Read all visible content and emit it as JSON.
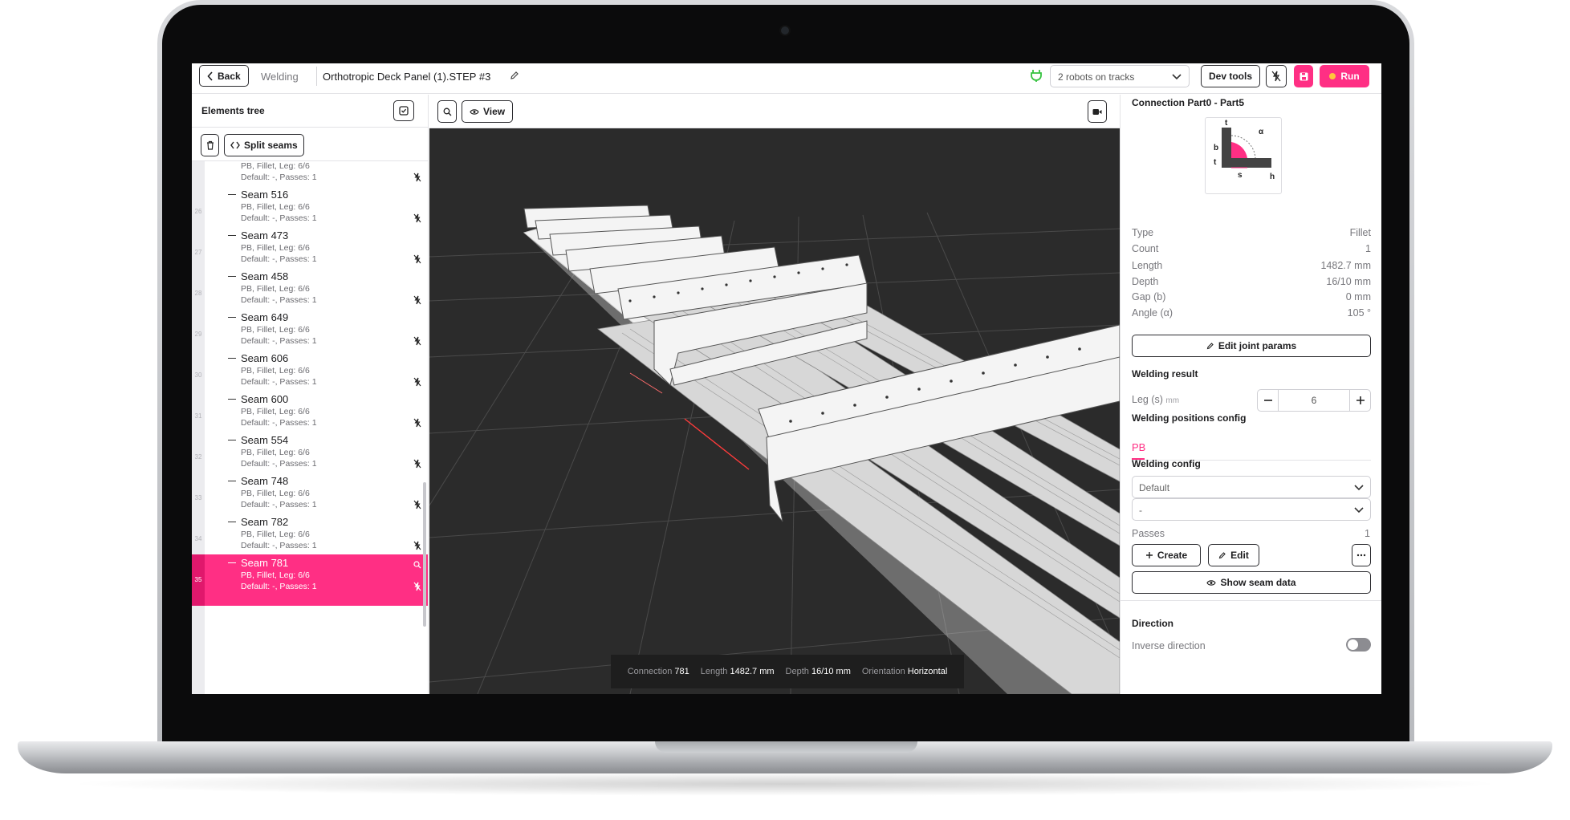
{
  "header": {
    "back_label": "Back",
    "section": "Welding",
    "document_title": "Orthotropic Deck Panel (1).STEP #3",
    "robot_select": "2 robots on tracks",
    "dev_tools_label": "Dev tools",
    "run_label": "Run",
    "accent_color": "#ff2f84"
  },
  "tree": {
    "title": "Elements tree",
    "split_seams_label": "Split seams",
    "partial_top": {
      "line1": "PB, Fillet, Leg: 6/6",
      "line2": "Default: -, Passes: 1"
    },
    "seams": [
      {
        "num": "26",
        "name": "Seam 516",
        "line1": "PB, Fillet, Leg: 6/6",
        "line2": "Default: -, Passes: 1"
      },
      {
        "num": "27",
        "name": "Seam 473",
        "line1": "PB, Fillet, Leg: 6/6",
        "line2": "Default: -, Passes: 1"
      },
      {
        "num": "28",
        "name": "Seam 458",
        "line1": "PB, Fillet, Leg: 6/6",
        "line2": "Default: -, Passes: 1"
      },
      {
        "num": "29",
        "name": "Seam 649",
        "line1": "PB, Fillet, Leg: 6/6",
        "line2": "Default: -, Passes: 1"
      },
      {
        "num": "30",
        "name": "Seam 606",
        "line1": "PB, Fillet, Leg: 6/6",
        "line2": "Default: -, Passes: 1"
      },
      {
        "num": "31",
        "name": "Seam 600",
        "line1": "PB, Fillet, Leg: 6/6",
        "line2": "Default: -, Passes: 1"
      },
      {
        "num": "32",
        "name": "Seam 554",
        "line1": "PB, Fillet, Leg: 6/6",
        "line2": "Default: -, Passes: 1"
      },
      {
        "num": "33",
        "name": "Seam 748",
        "line1": "PB, Fillet, Leg: 6/6",
        "line2": "Default: -, Passes: 1"
      },
      {
        "num": "34",
        "name": "Seam 782",
        "line1": "PB, Fillet, Leg: 6/6",
        "line2": "Default: -, Passes: 1"
      },
      {
        "num": "35",
        "name": "Seam 781",
        "line1": "PB, Fillet, Leg: 6/6",
        "line2": "Default: -, Passes: 1",
        "selected": true
      }
    ]
  },
  "viewport": {
    "view_label": "View",
    "status": {
      "connection_label": "Connection",
      "connection_value": "781",
      "length_label": "Length",
      "length_value": "1482.7 mm",
      "depth_label": "Depth",
      "depth_value": "16/10 mm",
      "orientation_label": "Orientation",
      "orientation_value": "Horizontal"
    }
  },
  "details": {
    "connection_title": "Connection Part0 - Part5",
    "diagram_labels": {
      "t_top": "t",
      "a": "α",
      "b": "b",
      "t_left": "t",
      "s": "s",
      "h": "h"
    },
    "properties": [
      {
        "key": "Type",
        "value": "Fillet"
      },
      {
        "key": "Count",
        "value": "1"
      },
      {
        "key": "Length",
        "value": "1482.7 mm"
      },
      {
        "key": "Depth",
        "value": "16/10 mm"
      },
      {
        "key": "Gap (b)",
        "value": "0 mm"
      },
      {
        "key": "Angle (α)",
        "value": "105 °"
      }
    ],
    "edit_joint_label": "Edit joint params",
    "welding_result_title": "Welding result",
    "leg_label": "Leg (s)",
    "leg_unit": "mm",
    "leg_value": "6",
    "positions_title": "Welding positions config",
    "position_tab": "PB",
    "welding_config_title": "Welding config",
    "config_select": "Default",
    "config_sub_select": "-",
    "passes_label": "Passes",
    "passes_value": "1",
    "create_label": "Create",
    "edit_label": "Edit",
    "show_seam_data_label": "Show seam data",
    "direction_title": "Direction",
    "inverse_label": "Inverse direction",
    "inverse_enabled": false
  }
}
